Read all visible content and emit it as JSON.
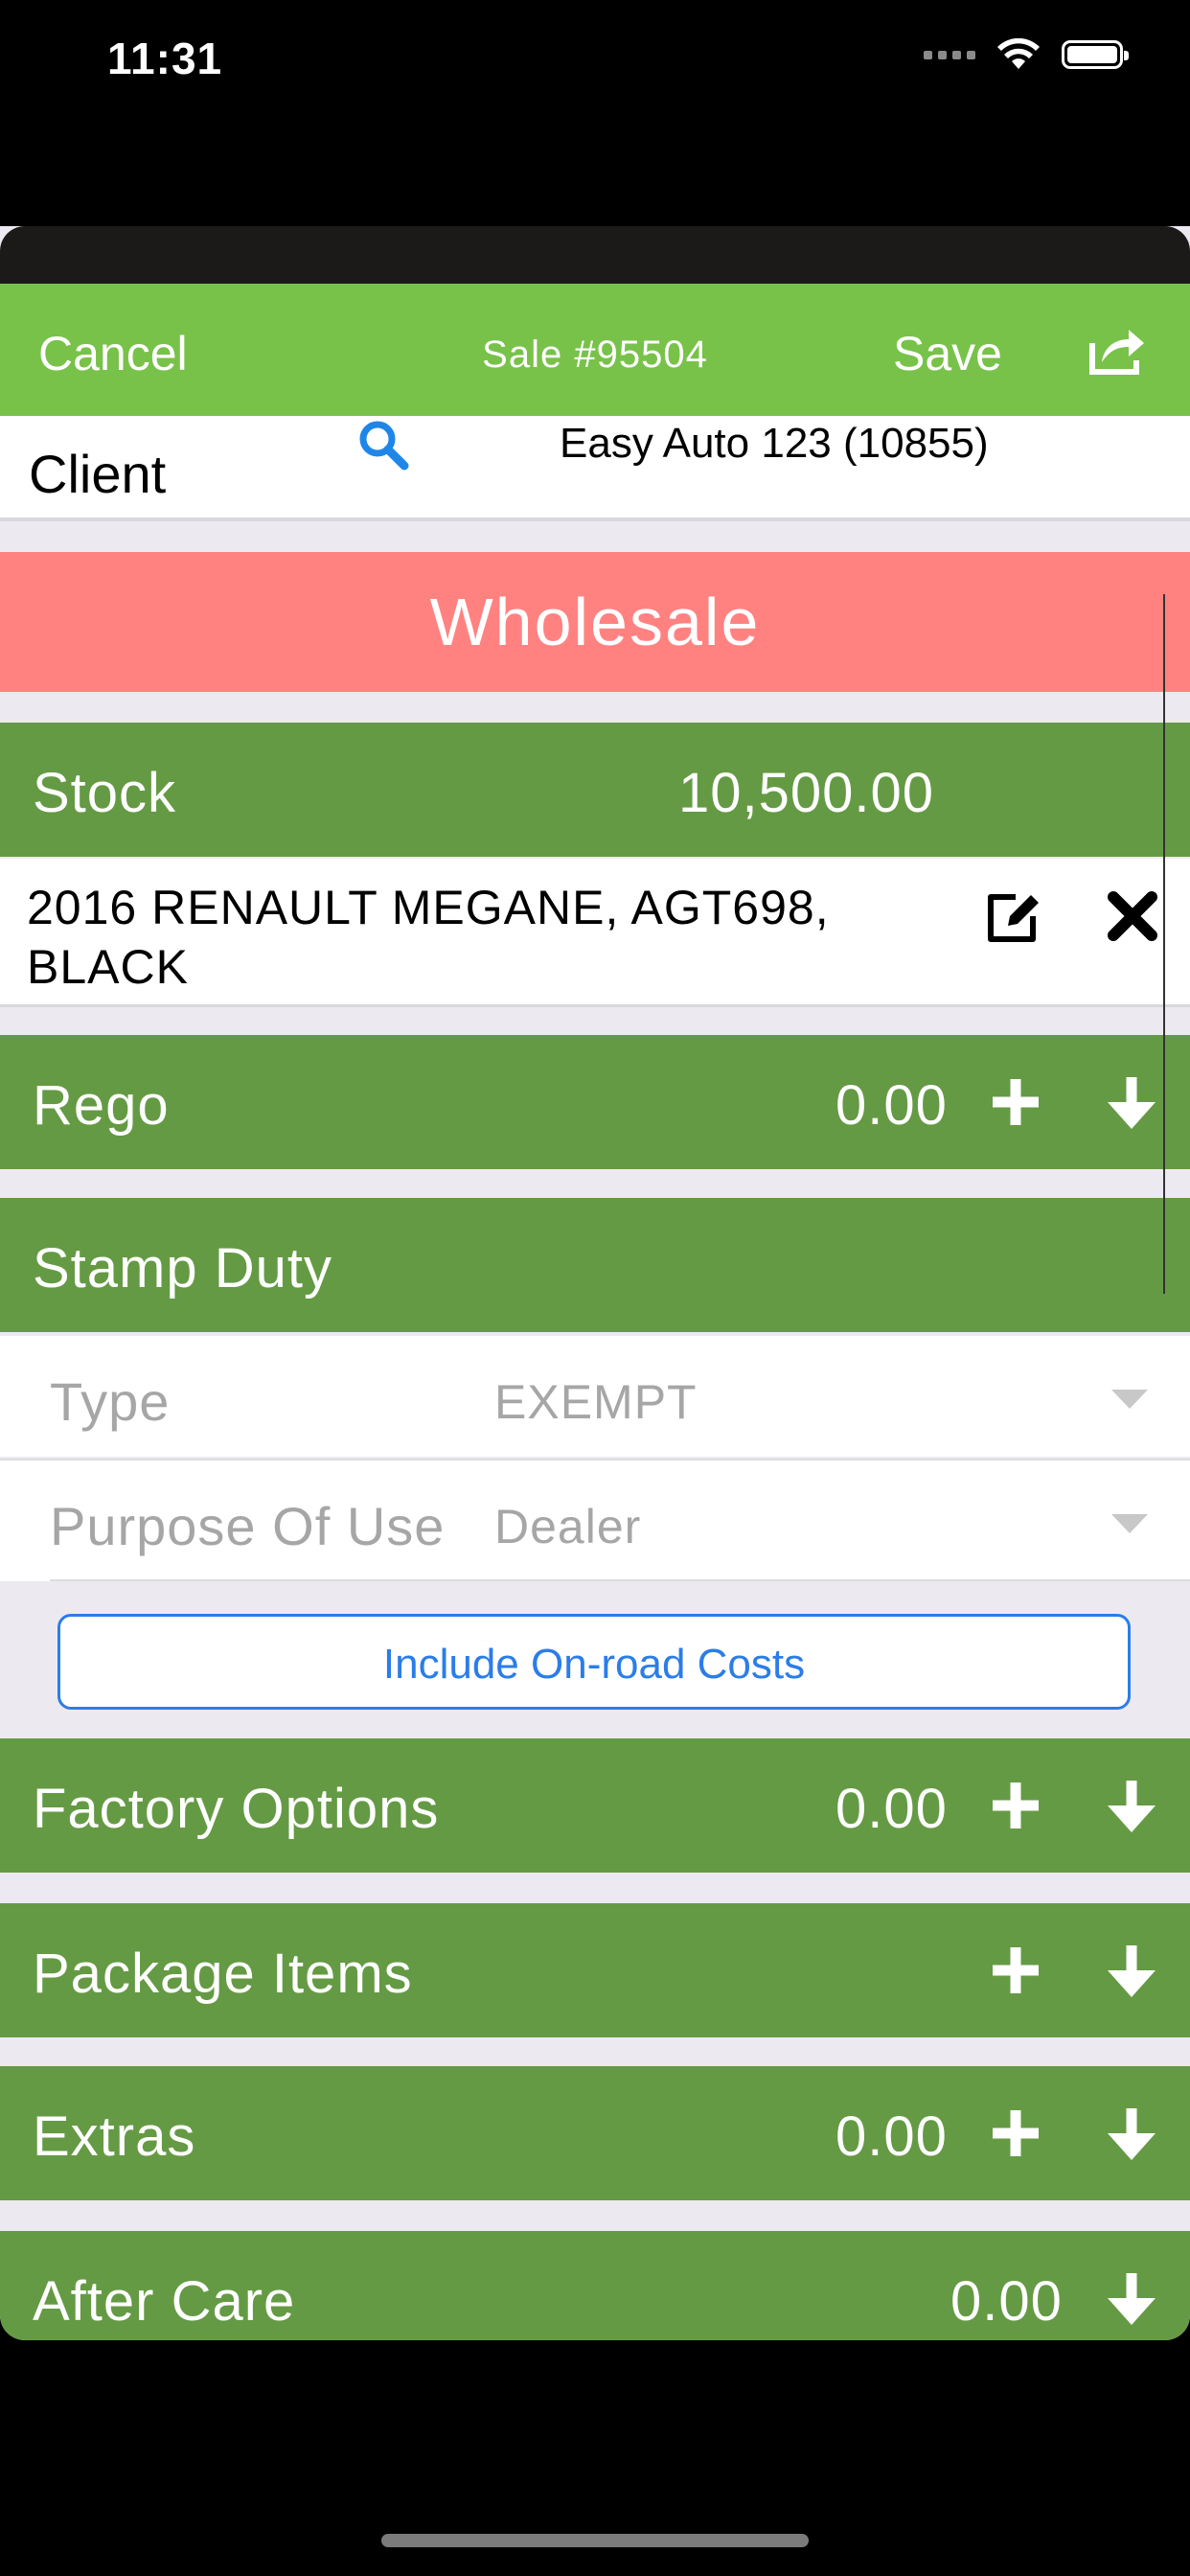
{
  "status_bar": {
    "time": "11:31"
  },
  "navbar": {
    "cancel_label": "Cancel",
    "title": "Sale #95504",
    "save_label": "Save",
    "share_icon": "share-icon"
  },
  "client": {
    "label": "Client",
    "value": "Easy Auto 123 (10855)"
  },
  "sale_type": "Wholesale",
  "stock": {
    "label": "Stock",
    "value": "10,500.00",
    "vehicle": "2016 RENAULT MEGANE, AGT698, BLACK"
  },
  "rego": {
    "label": "Rego",
    "value": "0.00"
  },
  "stamp_duty": {
    "label": "Stamp Duty",
    "type_label": "Type",
    "type_value": "EXEMPT",
    "purpose_label": "Purpose Of Use",
    "purpose_value": "Dealer",
    "onroad_button": "Include On-road Costs"
  },
  "factory_options": {
    "label": "Factory Options",
    "value": "0.00"
  },
  "package_items": {
    "label": "Package Items"
  },
  "extras": {
    "label": "Extras",
    "value": "0.00"
  },
  "after_care": {
    "label": "After Care",
    "value": "0.00"
  },
  "colors": {
    "navbar": "#78c24a",
    "section": "#659a44",
    "wholesale": "#ff8281",
    "link": "#2b7de8"
  }
}
